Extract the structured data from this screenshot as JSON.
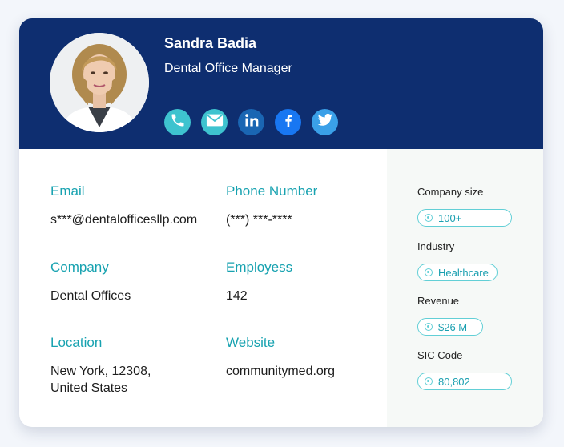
{
  "profile": {
    "name": "Sandra Badia",
    "job_title": "Dental Office Manager",
    "avatar_icon": "person-photo"
  },
  "social": [
    {
      "icon": "phone-icon",
      "color": "#3ec3cf"
    },
    {
      "icon": "email-icon",
      "color": "#3ec3cf"
    },
    {
      "icon": "linkedin-icon",
      "color": "#1a66b3"
    },
    {
      "icon": "facebook-icon",
      "color": "#1877f2"
    },
    {
      "icon": "twitter-icon",
      "color": "#3aa0e8"
    }
  ],
  "fields": {
    "email": {
      "label": "Email",
      "value": "s***@dentalofficesllp.com"
    },
    "phone": {
      "label": "Phone Number",
      "value": "(***) ***-****"
    },
    "company": {
      "label": "Company",
      "value": "Dental Offices"
    },
    "employees": {
      "label": "Employess",
      "value": "142"
    },
    "location": {
      "label": "Location",
      "value_line1": "New York, 12308,",
      "value_line2": "United States"
    },
    "website": {
      "label": "Website",
      "value": "communitymed.org"
    }
  },
  "sidebar": {
    "company_size": {
      "label": "Company size",
      "value": "100+"
    },
    "industry": {
      "label": "Industry",
      "value": "Healthcare"
    },
    "revenue": {
      "label": "Revenue",
      "value": "$26 M"
    },
    "sic_code": {
      "label": "SIC Code",
      "value": "80,802"
    }
  },
  "colors": {
    "header": "#0e2e70",
    "accent": "#17a2b0",
    "pill_border": "#62cfd6"
  }
}
